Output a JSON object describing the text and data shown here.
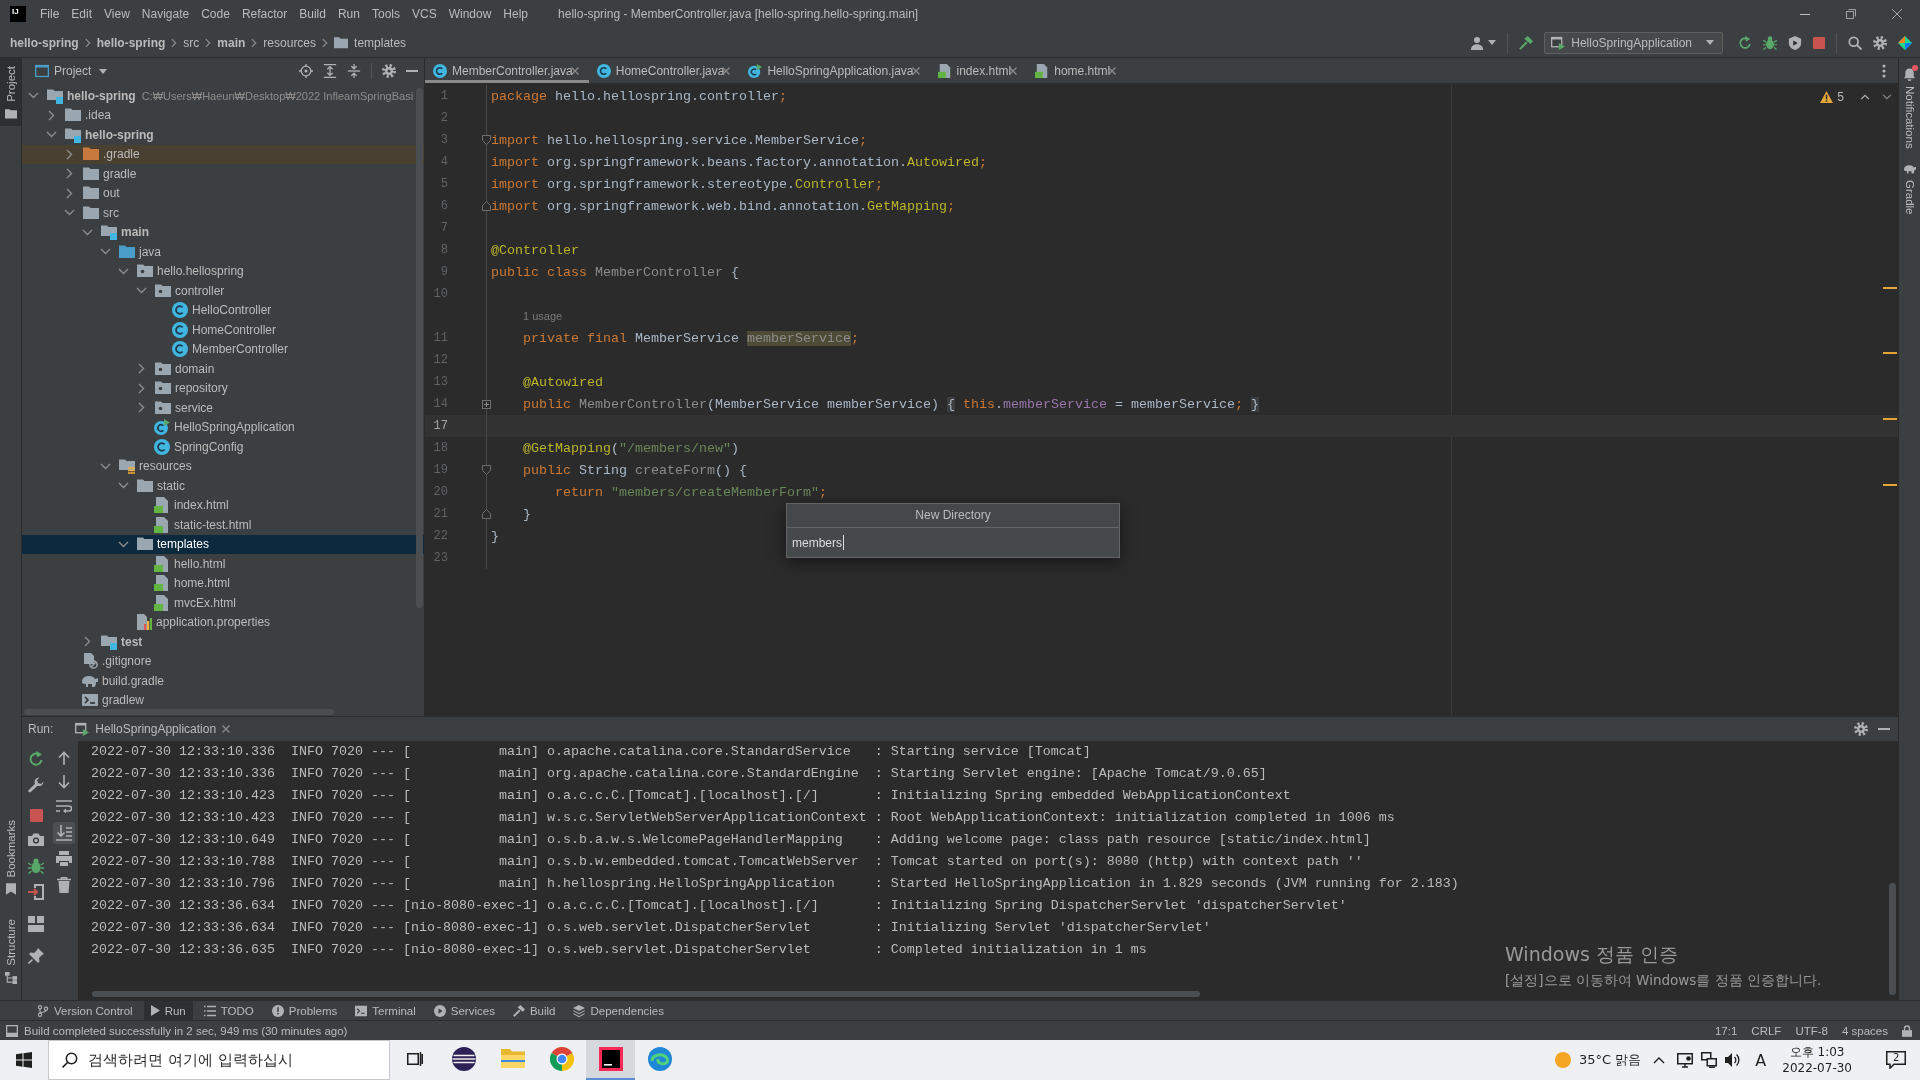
{
  "window": {
    "logo": "IJ",
    "title": "hello-spring - MemberController.java [hello-spring.hello-spring.main]"
  },
  "menu": [
    "File",
    "Edit",
    "View",
    "Navigate",
    "Code",
    "Refactor",
    "Build",
    "Run",
    "Tools",
    "VCS",
    "Window",
    "Help"
  ],
  "breadcrumbs": [
    {
      "label": "hello-spring",
      "bold": true,
      "kind": "text"
    },
    {
      "label": "hello-spring",
      "bold": true,
      "kind": "text"
    },
    {
      "label": "src",
      "bold": false,
      "kind": "text"
    },
    {
      "label": "main",
      "bold": true,
      "kind": "text"
    },
    {
      "label": "resources",
      "bold": false,
      "kind": "text"
    },
    {
      "label": "templates",
      "bold": false,
      "kind": "folder"
    }
  ],
  "run_config": {
    "label": "HelloSpringApplication"
  },
  "left_strip": [
    {
      "label": "Project",
      "kind": "folder",
      "docked_bottom": false,
      "selected": true
    },
    {
      "label": "Bookmarks",
      "kind": "bookmark",
      "docked_bottom": true,
      "selected": false
    },
    {
      "label": "Structure",
      "kind": "structure",
      "docked_bottom": true,
      "selected": false
    }
  ],
  "right_strip": [
    {
      "label": "Notifications",
      "kind": "bell",
      "unread": true
    },
    {
      "label": "Gradle",
      "kind": "elephant",
      "unread": false
    }
  ],
  "project_panel": {
    "title": "Project",
    "tree": [
      {
        "label": "hello-spring",
        "path": "C:₩Users₩Haeun₩Desktop₩2022 InflearnSpringBasi",
        "kind": "module",
        "expanded": true,
        "selected": false,
        "children": [
          {
            "label": ".idea",
            "kind": "folder",
            "expanded": false,
            "selected": false
          },
          {
            "label": "hello-spring",
            "kind": "module",
            "expanded": true,
            "selected": false,
            "children": [
              {
                "label": ".gradle",
                "kind": "excluded",
                "expanded": false,
                "selected": false
              },
              {
                "label": "gradle",
                "kind": "folder",
                "expanded": false,
                "selected": false
              },
              {
                "label": "out",
                "kind": "folder",
                "expanded": false,
                "selected": false
              },
              {
                "label": "src",
                "kind": "folder",
                "expanded": true,
                "selected": false,
                "children": [
                  {
                    "label": "main",
                    "kind": "source-set",
                    "expanded": true,
                    "selected": false,
                    "children": [
                      {
                        "label": "java",
                        "kind": "source-root",
                        "expanded": true,
                        "selected": false,
                        "children": [
                          {
                            "label": "hello.hellospring",
                            "kind": "package",
                            "expanded": true,
                            "selected": false,
                            "children": [
                              {
                                "label": "controller",
                                "kind": "package",
                                "expanded": true,
                                "selected": false,
                                "children": [
                                  {
                                    "label": "HelloController",
                                    "kind": "class",
                                    "selected": false
                                  },
                                  {
                                    "label": "HomeController",
                                    "kind": "class",
                                    "selected": false
                                  },
                                  {
                                    "label": "MemberController",
                                    "kind": "class",
                                    "selected": false
                                  }
                                ]
                              },
                              {
                                "label": "domain",
                                "kind": "package",
                                "expanded": false,
                                "selected": false
                              },
                              {
                                "label": "repository",
                                "kind": "package",
                                "expanded": false,
                                "selected": false
                              },
                              {
                                "label": "service",
                                "kind": "package",
                                "expanded": false,
                                "selected": false
                              },
                              {
                                "label": "HelloSpringApplication",
                                "kind": "app-class",
                                "selected": false
                              },
                              {
                                "label": "SpringConfig",
                                "kind": "class",
                                "selected": false
                              }
                            ]
                          }
                        ]
                      },
                      {
                        "label": "resources",
                        "kind": "resources-root",
                        "expanded": true,
                        "selected": false,
                        "children": [
                          {
                            "label": "static",
                            "kind": "folder",
                            "expanded": true,
                            "selected": false,
                            "children": [
                              {
                                "label": "index.html",
                                "kind": "html",
                                "selected": false
                              },
                              {
                                "label": "static-test.html",
                                "kind": "html",
                                "selected": false
                              }
                            ]
                          },
                          {
                            "label": "templates",
                            "kind": "folder",
                            "expanded": true,
                            "selected": true,
                            "children": [
                              {
                                "label": "hello.html",
                                "kind": "html",
                                "selected": false
                              },
                              {
                                "label": "home.html",
                                "kind": "html",
                                "selected": false
                              },
                              {
                                "label": "mvcEx.html",
                                "kind": "html",
                                "selected": false
                              }
                            ]
                          },
                          {
                            "label": "application.properties",
                            "kind": "properties",
                            "selected": false
                          }
                        ]
                      }
                    ]
                  },
                  {
                    "label": "test",
                    "kind": "source-set",
                    "expanded": false,
                    "selected": false
                  }
                ]
              },
              {
                "label": ".gitignore",
                "kind": "ignore-file",
                "selected": false
              },
              {
                "label": "build.gradle",
                "kind": "gradle-file",
                "selected": false
              },
              {
                "label": "gradlew",
                "kind": "script-file",
                "selected": false
              }
            ]
          }
        ]
      }
    ]
  },
  "editor": {
    "tabs": [
      {
        "label": "MemberController.java",
        "kind": "class",
        "selected": true
      },
      {
        "label": "HomeController.java",
        "kind": "class",
        "selected": false
      },
      {
        "label": "HelloSpringApplication.java",
        "kind": "app-class",
        "selected": false
      },
      {
        "label": "index.html",
        "kind": "html",
        "selected": false
      },
      {
        "label": "home.html",
        "kind": "html",
        "selected": false
      }
    ],
    "warnings": "5",
    "lines": [
      {
        "kind": "code",
        "number": "1",
        "current": false,
        "tokens": [
          {
            "text": "package",
            "kind": "keyword"
          },
          {
            "text": " hello.hellospring.controller",
            "kind": "plain"
          },
          {
            "text": ";",
            "kind": "keyword"
          }
        ]
      },
      {
        "kind": "code",
        "number": "2",
        "current": false
      },
      {
        "kind": "code",
        "number": "3",
        "current": false,
        "fold_open": true,
        "tokens": [
          {
            "text": "import",
            "kind": "keyword"
          },
          {
            "text": " hello.hellospring.service.MemberService",
            "kind": "plain"
          },
          {
            "text": ";",
            "kind": "keyword"
          }
        ]
      },
      {
        "kind": "code",
        "number": "4",
        "current": false,
        "tokens": [
          {
            "text": "import",
            "kind": "keyword"
          },
          {
            "text": " org.springframework.beans.factory.annotation.",
            "kind": "plain"
          },
          {
            "text": "Autowired",
            "kind": "annotation"
          },
          {
            "text": ";",
            "kind": "keyword"
          }
        ]
      },
      {
        "kind": "code",
        "number": "5",
        "current": false,
        "tokens": [
          {
            "text": "import",
            "kind": "keyword"
          },
          {
            "text": " org.springframework.stereotype.",
            "kind": "plain"
          },
          {
            "text": "Controller",
            "kind": "annotation"
          },
          {
            "text": ";",
            "kind": "keyword"
          }
        ]
      },
      {
        "kind": "code",
        "number": "6",
        "current": false,
        "fold_close": true,
        "tokens": [
          {
            "text": "import",
            "kind": "keyword"
          },
          {
            "text": " org.springframework.web.bind.annotation.",
            "kind": "plain"
          },
          {
            "text": "GetMapping",
            "kind": "annotation"
          },
          {
            "text": ";",
            "kind": "keyword"
          }
        ]
      },
      {
        "kind": "code",
        "number": "7",
        "current": false
      },
      {
        "kind": "code",
        "number": "8",
        "current": false,
        "tokens": [
          {
            "text": "@Controller",
            "kind": "annotation"
          }
        ]
      },
      {
        "kind": "code",
        "number": "9",
        "current": false,
        "tokens": [
          {
            "text": "public class ",
            "kind": "keyword"
          },
          {
            "text": "MemberController",
            "kind": "unused"
          },
          {
            "text": " {",
            "kind": "plain"
          }
        ]
      },
      {
        "kind": "code",
        "number": "10",
        "current": false
      },
      {
        "kind": "hint",
        "text": "1 usage"
      },
      {
        "kind": "code",
        "number": "11",
        "current": false,
        "tokens": [
          {
            "text": "    private final",
            "kind": "keyword"
          },
          {
            "text": " MemberService ",
            "kind": "plain"
          },
          {
            "text": "memberService",
            "kind": "highlighted"
          },
          {
            "text": ";",
            "kind": "keyword"
          }
        ]
      },
      {
        "kind": "code",
        "number": "12",
        "current": false
      },
      {
        "kind": "code",
        "number": "13",
        "current": false,
        "tokens": [
          {
            "text": "    @Autowired",
            "kind": "annotation"
          }
        ]
      },
      {
        "kind": "code",
        "number": "14",
        "current": false,
        "folded": true,
        "tokens": [
          {
            "text": "    public ",
            "kind": "keyword"
          },
          {
            "text": "MemberController",
            "kind": "unused"
          },
          {
            "text": "(MemberService memberService) ",
            "kind": "plain"
          },
          {
            "text": "{",
            "kind": "folded"
          },
          {
            "text": " this",
            "kind": "keyword"
          },
          {
            "text": ".",
            "kind": "plain"
          },
          {
            "text": "memberService",
            "kind": "field"
          },
          {
            "text": " = memberService",
            "kind": "plain"
          },
          {
            "text": "; ",
            "kind": "keyword"
          },
          {
            "text": "}",
            "kind": "folded"
          }
        ]
      },
      {
        "kind": "code",
        "number": "17",
        "current": true
      },
      {
        "kind": "code",
        "number": "18",
        "current": false,
        "tokens": [
          {
            "text": "    @GetMapping",
            "kind": "annotation"
          },
          {
            "text": "(",
            "kind": "plain"
          },
          {
            "text": "\"/members/new\"",
            "kind": "string"
          },
          {
            "text": ")",
            "kind": "plain"
          }
        ]
      },
      {
        "kind": "code",
        "number": "19",
        "current": false,
        "fold_open": true,
        "tokens": [
          {
            "text": "    public",
            "kind": "keyword"
          },
          {
            "text": " String ",
            "kind": "plain"
          },
          {
            "text": "createForm",
            "kind": "unused"
          },
          {
            "text": "() {",
            "kind": "plain"
          }
        ]
      },
      {
        "kind": "code",
        "number": "20",
        "current": false,
        "tokens": [
          {
            "text": "        return ",
            "kind": "keyword"
          },
          {
            "text": "\"members/createMemberForm\"",
            "kind": "string"
          },
          {
            "text": ";",
            "kind": "keyword"
          }
        ]
      },
      {
        "kind": "code",
        "number": "21",
        "current": false,
        "fold_close": true,
        "tokens": [
          {
            "text": "    }",
            "kind": "plain"
          }
        ]
      },
      {
        "kind": "code",
        "number": "22",
        "current": false,
        "tokens": [
          {
            "text": "}",
            "kind": "plain"
          }
        ]
      },
      {
        "kind": "code",
        "number": "23",
        "current": false
      }
    ],
    "popup": {
      "title": "New Directory",
      "value": "members"
    }
  },
  "run_panel": {
    "label": "Run:",
    "tab": "HelloSpringApplication",
    "autoscroll": true,
    "lines": [
      "2022-07-30 12:33:10.336  INFO 7020 --- [           main] o.apache.catalina.core.StandardService   : Starting service [Tomcat]",
      "2022-07-30 12:33:10.336  INFO 7020 --- [           main] org.apache.catalina.core.StandardEngine  : Starting Servlet engine: [Apache Tomcat/9.0.65]",
      "2022-07-30 12:33:10.423  INFO 7020 --- [           main] o.a.c.c.C.[Tomcat].[localhost].[/]       : Initializing Spring embedded WebApplicationContext",
      "2022-07-30 12:33:10.423  INFO 7020 --- [           main] w.s.c.ServletWebServerApplicationContext : Root WebApplicationContext: initialization completed in 1006 ms",
      "2022-07-30 12:33:10.649  INFO 7020 --- [           main] o.s.b.a.w.s.WelcomePageHandlerMapping    : Adding welcome page: class path resource [static/index.html]",
      "2022-07-30 12:33:10.788  INFO 7020 --- [           main] o.s.b.w.embedded.tomcat.TomcatWebServer  : Tomcat started on port(s): 8080 (http) with context path ''",
      "2022-07-30 12:33:10.796  INFO 7020 --- [           main] h.hellospring.HelloSpringApplication     : Started HelloSpringApplication in 1.829 seconds (JVM running for 2.183)",
      "2022-07-30 12:33:36.634  INFO 7020 --- [nio-8080-exec-1] o.a.c.c.C.[Tomcat].[localhost].[/]       : Initializing Spring DispatcherServlet 'dispatcherServlet'",
      "2022-07-30 12:33:36.634  INFO 7020 --- [nio-8080-exec-1] o.s.web.servlet.DispatcherServlet        : Initializing Servlet 'dispatcherServlet'",
      "2022-07-30 12:33:36.635  INFO 7020 --- [nio-8080-exec-1] o.s.web.servlet.DispatcherServlet        : Completed initialization in 1 ms"
    ]
  },
  "tool_tabs": [
    {
      "label": "Version Control",
      "kind": "vcs",
      "selected": false
    },
    {
      "label": "Run",
      "kind": "run",
      "selected": true
    },
    {
      "label": "TODO",
      "kind": "list",
      "selected": false
    },
    {
      "label": "Problems",
      "kind": "info",
      "selected": false
    },
    {
      "label": "Terminal",
      "kind": "terminal",
      "selected": false
    },
    {
      "label": "Services",
      "kind": "services",
      "selected": false
    },
    {
      "label": "Build",
      "kind": "hammer",
      "selected": false
    },
    {
      "label": "Dependencies",
      "kind": "layers",
      "selected": false
    }
  ],
  "status_bar": {
    "message": "Build completed successfully in 2 sec, 949 ms (30 minutes ago)",
    "position": "17:1",
    "line_separator": "CRLF",
    "encoding": "UTF-8",
    "indent": "4 spaces"
  },
  "taskbar": {
    "search": {
      "placeholder": "검색하려면 여기에 입력하십시"
    },
    "apps": [
      {
        "kind": "task-view",
        "active": false
      },
      {
        "kind": "striped-circle",
        "active": false
      },
      {
        "kind": "folder",
        "active": false
      },
      {
        "kind": "tricolor",
        "active": false
      },
      {
        "kind": "square-app",
        "active": true
      },
      {
        "kind": "swirl",
        "active": false
      }
    ],
    "weather": "35°C 맑음",
    "ime": "A",
    "time": "오후 1:03",
    "date": "2022-07-30",
    "notifications": "2"
  },
  "activation": {
    "title": "Windows 정품 인증",
    "message": "[설정]으로 이동하여 Windows를 정품 인증합니다."
  }
}
